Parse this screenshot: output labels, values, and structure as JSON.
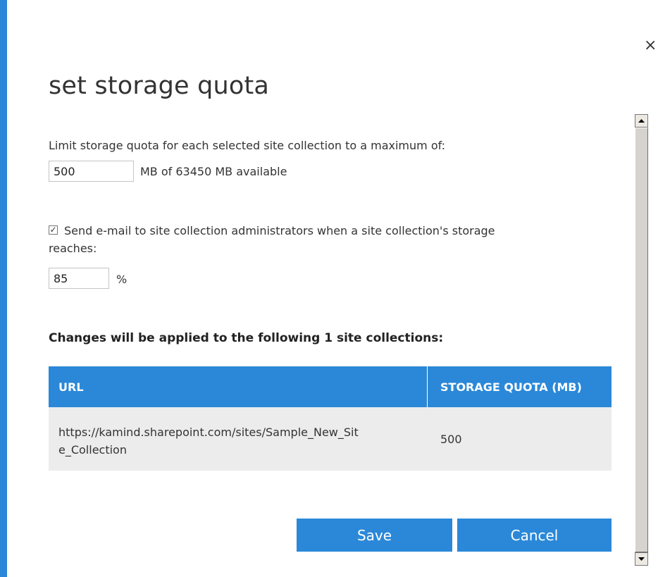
{
  "dialog": {
    "title": "set storage quota",
    "close_glyph": "×"
  },
  "quota": {
    "description": "Limit storage quota for each selected site collection to a maximum of:",
    "value": "500",
    "available_text": "MB of 63450 MB available"
  },
  "email_alert": {
    "checked": true,
    "check_glyph": "✓",
    "label_line1": "Send e-mail to site collection administrators when a site collection's storage",
    "label_line2": "reaches:",
    "percent_value": "85",
    "percent_symbol": "%"
  },
  "changes": {
    "heading": "Changes will be applied to the following 1 site collections:",
    "columns": [
      "URL",
      "STORAGE QUOTA (MB)"
    ],
    "rows": [
      {
        "url_line1": "https://kamind.sharepoint.com/sites/Sample_New_Sit",
        "url_line2": "e_Collection",
        "quota": "500"
      }
    ]
  },
  "actions": {
    "save_label": "Save",
    "cancel_label": "Cancel"
  },
  "scrollbar": {
    "up_icon": "scroll-up-arrow",
    "down_icon": "scroll-down-arrow"
  },
  "colors": {
    "accent": "#2b88d8",
    "row_background": "#ececec"
  }
}
